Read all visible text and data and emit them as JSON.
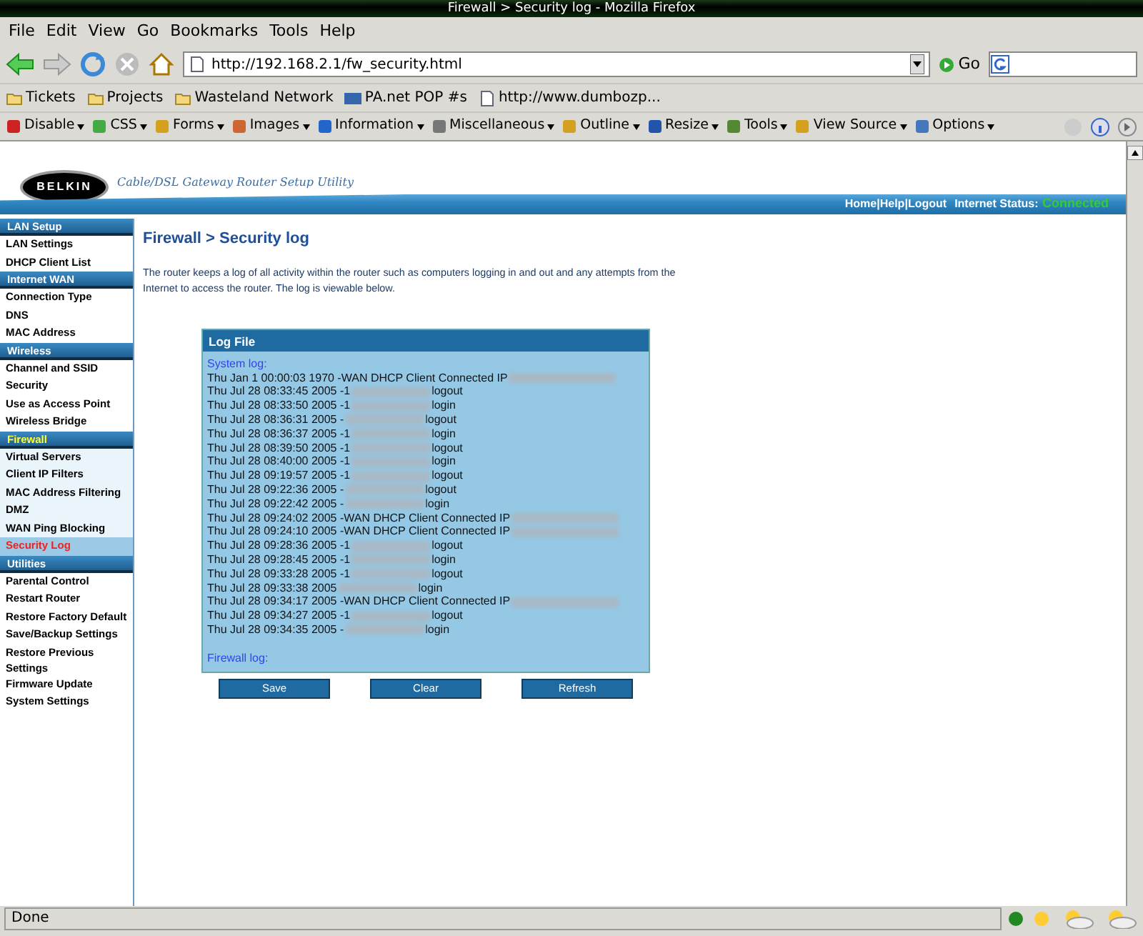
{
  "window": {
    "title": "Firewall > Security log - Mozilla Firefox"
  },
  "menu": [
    "File",
    "Edit",
    "View",
    "Go",
    "Bookmarks",
    "Tools",
    "Help"
  ],
  "address": {
    "url": "http://192.168.2.1/fw_security.html",
    "go": "Go"
  },
  "bookmarks": [
    {
      "label": "Tickets",
      "kind": "folder"
    },
    {
      "label": "Projects",
      "kind": "folder"
    },
    {
      "label": "Wasteland Network",
      "kind": "folder"
    },
    {
      "label": "PA.net POP #s",
      "kind": "site"
    },
    {
      "label": "http://www.dumbozp...",
      "kind": "page"
    }
  ],
  "dev_toolbar": [
    {
      "label": "Disable",
      "color": "#cc2222"
    },
    {
      "label": "CSS",
      "color": "#44aa44"
    },
    {
      "label": "Forms",
      "color": "#d4a020"
    },
    {
      "label": "Images",
      "color": "#cc6633"
    },
    {
      "label": "Information",
      "color": "#2266cc"
    },
    {
      "label": "Miscellaneous",
      "color": "#777777"
    },
    {
      "label": "Outline",
      "color": "#d4a020"
    },
    {
      "label": "Resize",
      "color": "#2255aa"
    },
    {
      "label": "Tools",
      "color": "#558833"
    },
    {
      "label": "View Source",
      "color": "#d4a020"
    },
    {
      "label": "Options",
      "color": "#4477bb"
    }
  ],
  "router": {
    "logo": "BELKIN",
    "subtitle": "Cable/DSL Gateway Router Setup Utility",
    "links": [
      "Home",
      "Help",
      "Logout"
    ],
    "separator": "|",
    "status_label": "Internet Status:",
    "status_value": "Connected"
  },
  "sidebar": [
    {
      "title": "LAN Setup",
      "active": false,
      "items": [
        {
          "label": "LAN Settings",
          "selected": false
        },
        {
          "label": "DHCP Client List",
          "selected": false
        }
      ]
    },
    {
      "title": "Internet WAN",
      "active": false,
      "items": [
        {
          "label": "Connection Type",
          "selected": false
        },
        {
          "label": "DNS",
          "selected": false
        },
        {
          "label": "MAC Address",
          "selected": false
        }
      ]
    },
    {
      "title": "Wireless",
      "active": false,
      "items": [
        {
          "label": "Channel and SSID",
          "selected": false
        },
        {
          "label": "Security",
          "selected": false
        },
        {
          "label": "Use as Access Point",
          "selected": false
        },
        {
          "label": "Wireless Bridge",
          "selected": false
        }
      ]
    },
    {
      "title": "Firewall",
      "active": true,
      "items": [
        {
          "label": "Virtual Servers",
          "selected": false
        },
        {
          "label": "Client IP Filters",
          "selected": false
        },
        {
          "label": "MAC Address Filtering",
          "selected": false
        },
        {
          "label": "DMZ",
          "selected": false
        },
        {
          "label": "WAN Ping Blocking",
          "selected": false
        },
        {
          "label": "Security Log",
          "selected": true
        }
      ]
    },
    {
      "title": "Utilities",
      "active": false,
      "items": [
        {
          "label": "Parental Control",
          "selected": false
        },
        {
          "label": "Restart Router",
          "selected": false
        },
        {
          "label": "Restore Factory Default",
          "selected": false
        },
        {
          "label": "Save/Backup Settings",
          "selected": false
        },
        {
          "label": "Restore Previous Settings",
          "selected": false
        },
        {
          "label": "Firmware Update",
          "selected": false
        },
        {
          "label": "System Settings",
          "selected": false
        }
      ]
    }
  ],
  "page": {
    "heading": "Firewall > Security log",
    "intro": "The router keeps a log of all activity within the router such as computers logging in and out and any attempts from the Internet to access the router. The log is viewable below."
  },
  "log": {
    "title": "Log File",
    "system_label": "System log:",
    "firewall_label": "Firewall log:",
    "entries": [
      {
        "text": "Thu Jan 1 00:00:03 1970 -WAN DHCP Client Connected IP"
      },
      {
        "text": "Thu Jul 28 08:33:45 2005 -1",
        "event": "logout"
      },
      {
        "text": "Thu Jul 28 08:33:50 2005 -1",
        "event": "login"
      },
      {
        "text": "Thu Jul 28 08:36:31 2005 -",
        "event": "logout"
      },
      {
        "text": "Thu Jul 28 08:36:37 2005 -1",
        "event": "login"
      },
      {
        "text": "Thu Jul 28 08:39:50 2005 -1",
        "event": "logout"
      },
      {
        "text": "Thu Jul 28 08:40:00 2005 -1",
        "event": "login"
      },
      {
        "text": "Thu Jul 28 09:19:57 2005 -1",
        "event": "logout"
      },
      {
        "text": "Thu Jul 28 09:22:36 2005 -",
        "event": "logout"
      },
      {
        "text": "Thu Jul 28 09:22:42 2005 -",
        "event": "login"
      },
      {
        "text": "Thu Jul 28 09:24:02 2005 -WAN DHCP Client Connected IP"
      },
      {
        "text": "Thu Jul 28 09:24:10 2005 -WAN DHCP Client Connected IP"
      },
      {
        "text": "Thu Jul 28 09:28:36 2005 -1",
        "event": "logout"
      },
      {
        "text": "Thu Jul 28 09:28:45 2005 -1",
        "event": "login"
      },
      {
        "text": "Thu Jul 28 09:33:28 2005 -1",
        "event": "logout"
      },
      {
        "text": "Thu Jul 28 09:33:38 2005",
        "event": "login"
      },
      {
        "text": "Thu Jul 28 09:34:17 2005 -WAN DHCP Client Connected IP"
      },
      {
        "text": "Thu Jul 28 09:34:27 2005 -1",
        "event": "logout"
      },
      {
        "text": "Thu Jul 28 09:34:35 2005 -",
        "event": "login"
      }
    ]
  },
  "buttons": [
    "Save",
    "Clear",
    "Refresh"
  ],
  "status_bar": {
    "text": "Done"
  }
}
